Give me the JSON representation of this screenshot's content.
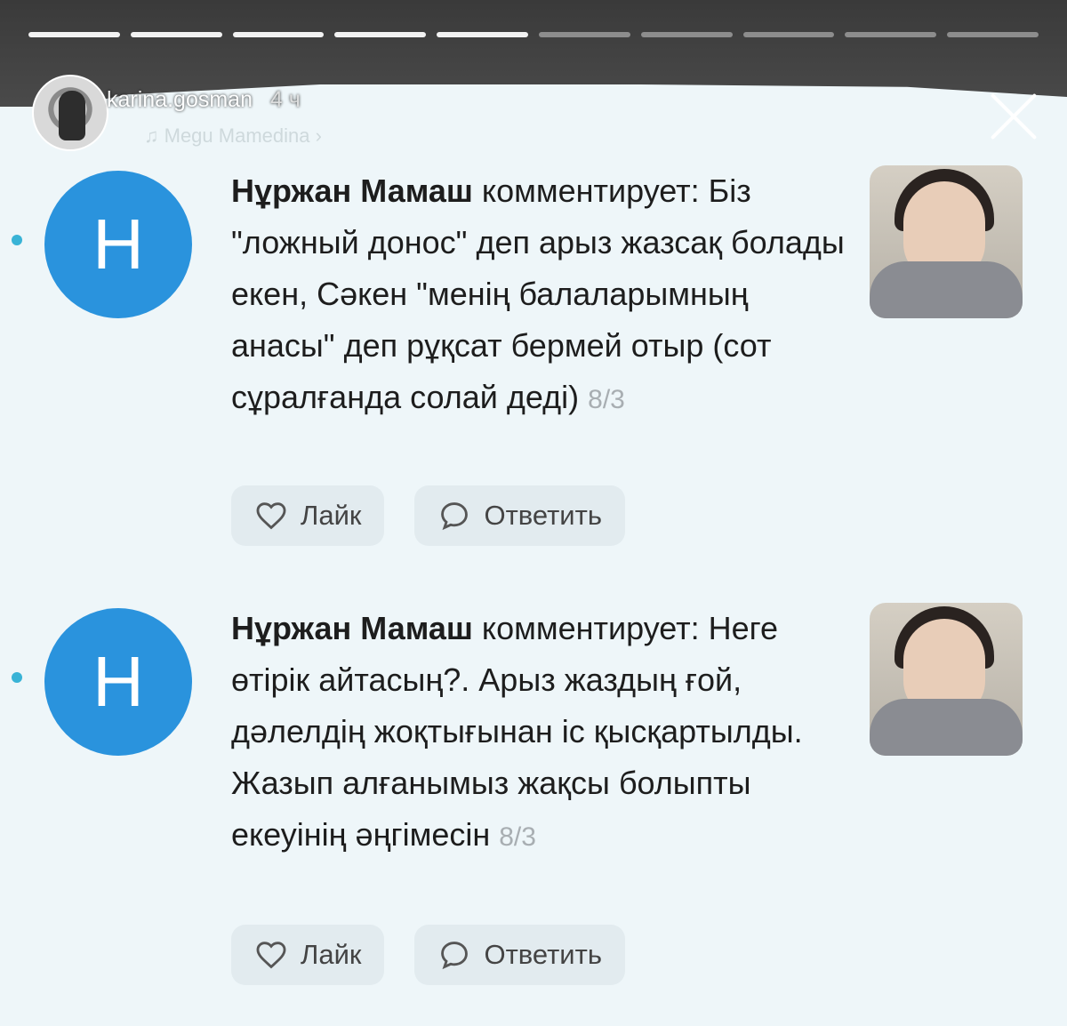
{
  "story": {
    "username": "karina.gosman",
    "time": "4 ч",
    "music": "Megu Mamedina",
    "progress_total": 10,
    "progress_done": 5
  },
  "comments": [
    {
      "avatar_letter": "H",
      "author": "Нұржан Мамаш",
      "action": "комментирует:",
      "text": "Біз \"ложный донос\" деп арыз жазсақ болады екен, Сәкен \"менің балаларымның анасы\" деп рұқсат бермей отыр (сот сұралғанда солай деді)",
      "date": "8/3",
      "like_label": "Лайк",
      "reply_label": "Ответить"
    },
    {
      "avatar_letter": "H",
      "author": "Нұржан Мамаш",
      "action": "комментирует:",
      "text": "Неге өтірік айтасың?. Арыз жаздың ғой, дәлелдің жоқтығынан іс қысқартылды. Жазып алғанымыз жақсы болыпты екеуінің әңгімесін",
      "date": "8/3",
      "like_label": "Лайк",
      "reply_label": "Ответить"
    }
  ],
  "colors": {
    "avatar_bg": "#2a93dd",
    "unread_dot": "#39b3d6",
    "background": "#eef6f9"
  }
}
